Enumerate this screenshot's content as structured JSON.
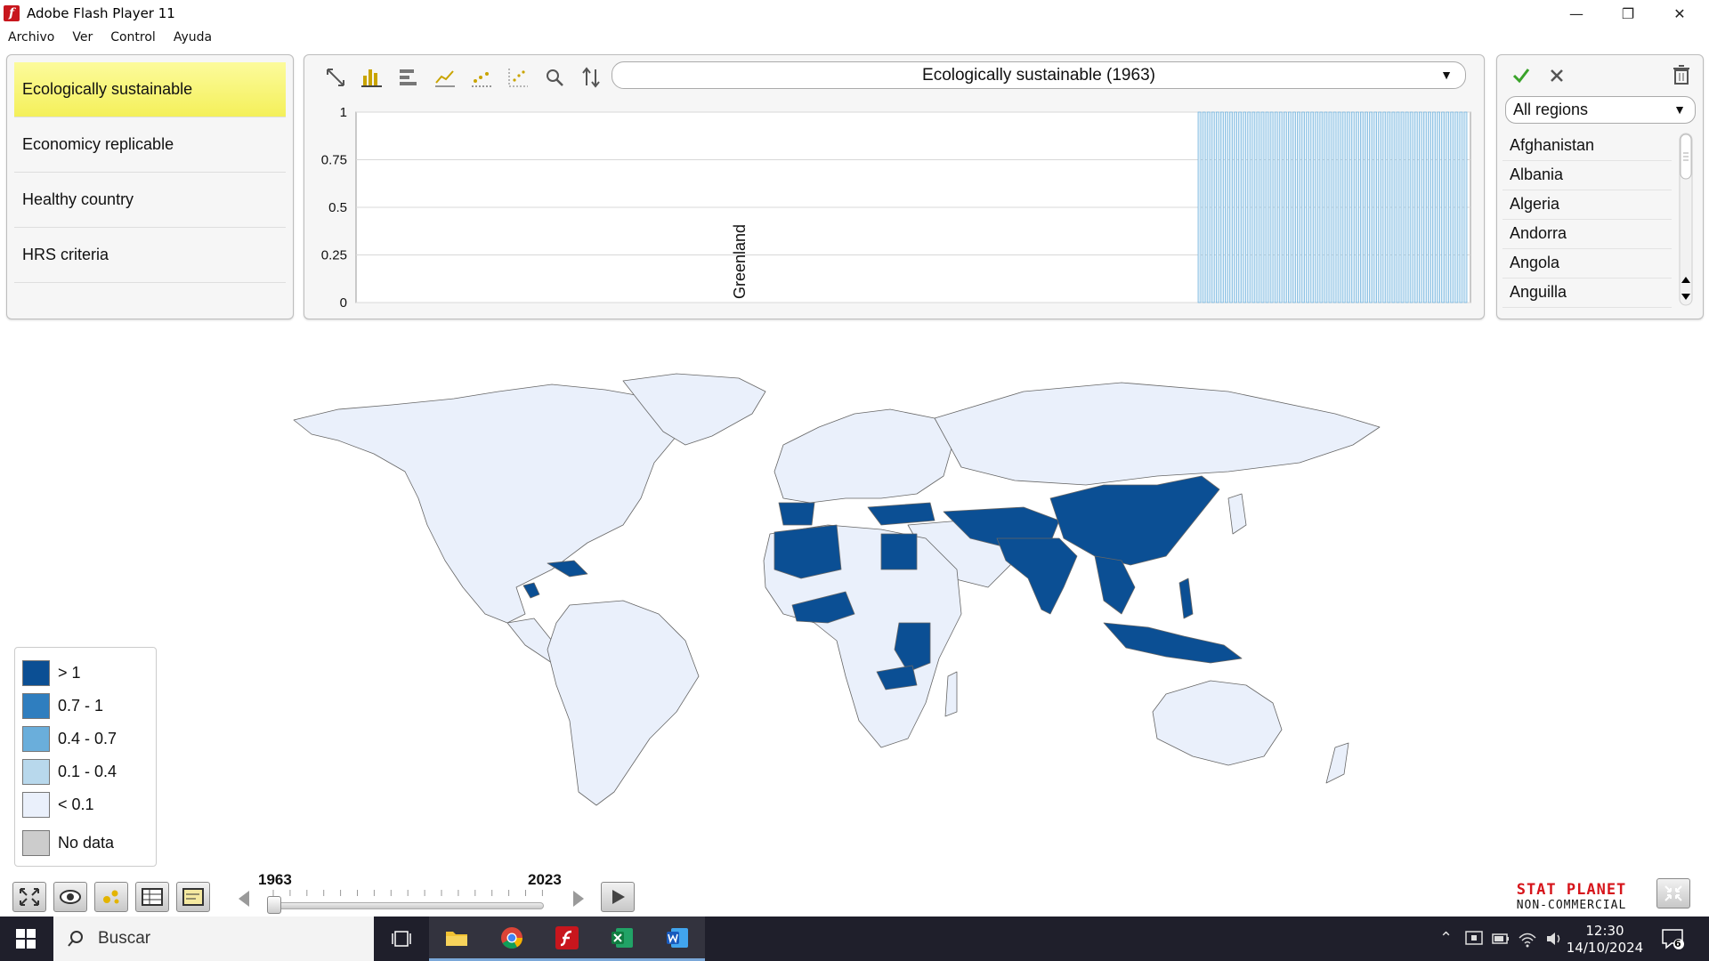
{
  "window": {
    "title": "Adobe Flash Player 11"
  },
  "menu": [
    "Archivo",
    "Ver",
    "Control",
    "Ayuda"
  ],
  "indicators": [
    {
      "label": "Ecologically sustainable",
      "active": true
    },
    {
      "label": "Economicy replicable",
      "active": false
    },
    {
      "label": "Healthy country",
      "active": false
    },
    {
      "label": "HRS criteria",
      "active": false
    }
  ],
  "chart": {
    "selected_indicator": "Ecologically sustainable (1963)",
    "toolbar": [
      "zoom-extent-icon",
      "bar-chart-icon",
      "horizontal-bar-icon",
      "line-chart-icon",
      "trend-icon",
      "scatter-icon",
      "search-icon",
      "sort-icon"
    ]
  },
  "chart_data": {
    "type": "bar",
    "title": "Ecologically sustainable (1963)",
    "ylim": [
      0,
      1
    ],
    "yticks": [
      "0",
      "0.25",
      "0.5",
      "0.75",
      "1"
    ],
    "labeled_category": "Greenland",
    "categories": [
      "Greenland"
    ],
    "values": [
      0
    ],
    "right_block_bar_count": 60,
    "right_block_value": 1
  },
  "regions": {
    "selected": "All regions",
    "countries": [
      "Afghanistan",
      "Albania",
      "Algeria",
      "Andorra",
      "Angola",
      "Anguilla"
    ]
  },
  "legend": [
    {
      "label": "> 1",
      "color": "#0b4f94"
    },
    {
      "label": "0.7 - 1",
      "color": "#2f7ebf"
    },
    {
      "label": "0.4 - 0.7",
      "color": "#6aaedb"
    },
    {
      "label": "0.1 - 0.4",
      "color": "#b8d8ec"
    },
    {
      "label": "< 0.1",
      "color": "#eaf0fb"
    },
    {
      "label": "No data",
      "color": "#cccccc"
    }
  ],
  "timeline": {
    "start": "1963",
    "end": "2023",
    "current": "1963"
  },
  "brand": {
    "main": "STAT PLANET",
    "sub": "NON-COMMERCIAL"
  },
  "taskbar": {
    "search_placeholder": "Buscar",
    "time": "12:30",
    "date": "14/10/2024",
    "notifications": "6"
  },
  "colors": {
    "accent": "#0b4f94",
    "land": "#eaf0fb",
    "highlight": "#fbf98a"
  }
}
